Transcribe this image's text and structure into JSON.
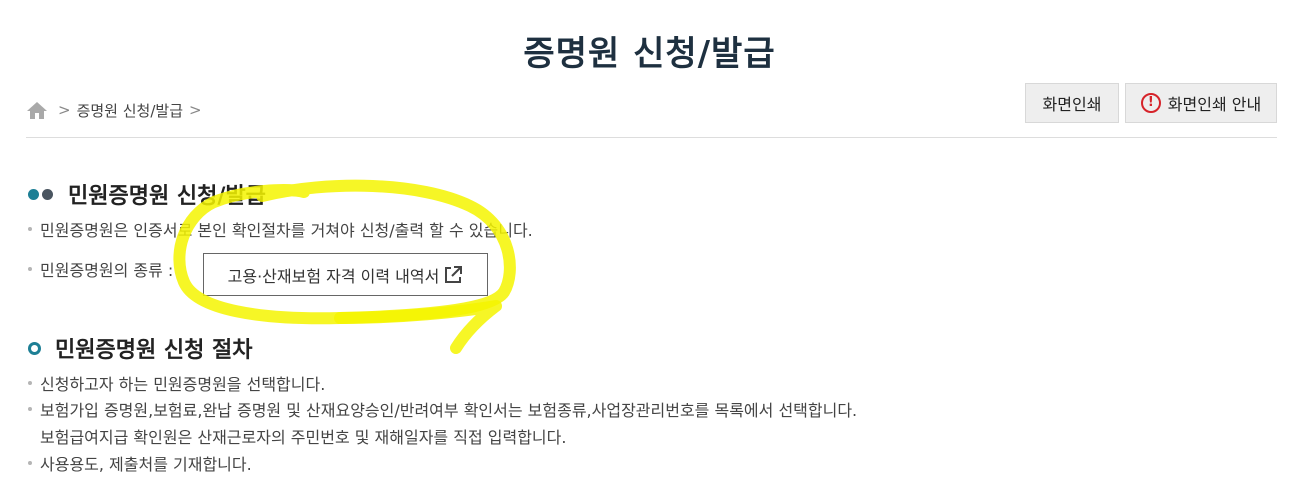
{
  "page": {
    "title": "증명원 신청/발급"
  },
  "breadcrumb": {
    "home_icon": "home-icon",
    "current": "증명원 신청/발급",
    "separator": ">"
  },
  "toolbar": {
    "print_label": "화면인쇄",
    "print_guide_label": "화면인쇄 안내",
    "warn_glyph": "!"
  },
  "section1": {
    "title": "민원증명원 신청/발급",
    "bullet1": "민원증명원은 인증서로 본인 확인절차를 거쳐야 신청/출력 할 수 있습니다.",
    "kinds_label": "민원증명원의 종류 :",
    "cert_link": "고용·산재보험 자격 이력 내역서"
  },
  "section2": {
    "title": "민원증명원 신청 절차",
    "steps": [
      "신청하고자 하는 민원증명원을 선택합니다.",
      "보험가입 증명원,보험료,완납 증명원 및 산재요양승인/반려여부 확인서는 보험종류,사업장관리번호를 목록에서 선택합니다.",
      "보험급여지급 확인원은 산재근로자의 주민번호 및 재해일자를 직접 입력합니다.",
      "사용용도, 제출처를 기재합니다."
    ]
  },
  "colors": {
    "title": "#1e3040",
    "accent": "#1d7f95",
    "highlight": "#f5f500",
    "warn": "#d6232a"
  }
}
